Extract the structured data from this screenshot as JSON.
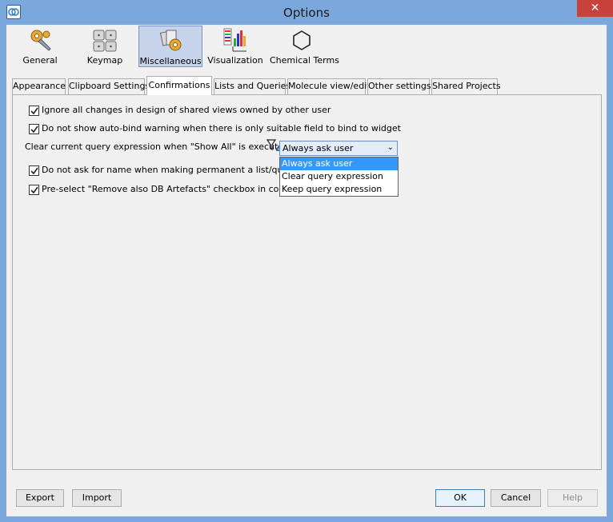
{
  "window": {
    "title": "Options",
    "close_glyph": "✕"
  },
  "categories": [
    {
      "label": "General",
      "icon": "gears-icon"
    },
    {
      "label": "Keymap",
      "icon": "keyboard-icon"
    },
    {
      "label": "Miscellaneous",
      "icon": "misc-icon",
      "active": true
    },
    {
      "label": "Visualization",
      "icon": "visualization-icon"
    },
    {
      "label": "Chemical Terms",
      "icon": "hexagon-icon"
    }
  ],
  "tabs": [
    {
      "label": "Appearance"
    },
    {
      "label": "Clipboard Settings"
    },
    {
      "label": "Confirmations",
      "active": true
    },
    {
      "label": "Lists and Queries"
    },
    {
      "label": "Molecule view/edit"
    },
    {
      "label": "Other settings"
    },
    {
      "label": "Shared Projects"
    }
  ],
  "confirmations": {
    "checks": [
      {
        "label": "Ignore all changes in design of shared views owned by other user",
        "checked": true
      },
      {
        "label": "Do not show auto-bind warning when there is only suitable field to bind to widget",
        "checked": true
      },
      {
        "label": "Do not ask for name when making permanent a list/query with",
        "checked": true
      },
      {
        "label": "Pre-select \"Remove also DB Artefacts\" checkbox in confirm de",
        "checked": true
      }
    ],
    "clear_query_label": "Clear current query expression when \"Show All\" is executed:",
    "clear_query_value": "Always ask user",
    "clear_query_options": [
      "Always ask user",
      "Clear query expression",
      "Keep query expression"
    ]
  },
  "buttons": {
    "export": "Export",
    "import": "Import",
    "ok": "OK",
    "cancel": "Cancel",
    "help": "Help"
  },
  "colors": {
    "titlebar": "#7aa8dc",
    "close": "#c7423a",
    "selection": "#3399ff"
  }
}
